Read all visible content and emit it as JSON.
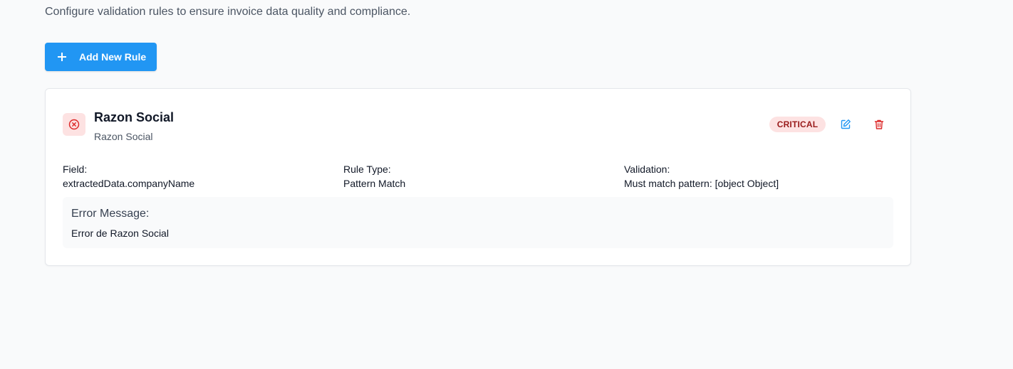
{
  "header": {
    "subtitle": "Configure validation rules to ensure invoice data quality and compliance."
  },
  "toolbar": {
    "add_label": "Add New Rule",
    "add_icon": "plus-icon",
    "accent_color": "#2196f3"
  },
  "rules": [
    {
      "title": "Razon Social",
      "description": "Razon Social",
      "status_icon": "x-circle-icon",
      "severity": "CRITICAL",
      "severity_color": "#991b1b",
      "severity_bg": "#fde2e2",
      "field_label": "Field:",
      "field_value": "extractedData.companyName",
      "type_label": "Rule Type:",
      "type_value": "Pattern Match",
      "validation_label": "Validation:",
      "validation_value": "Must match pattern: [object Object]",
      "error_label": "Error Message:",
      "error_value": "Error de Razon Social",
      "edit_icon": "edit-icon",
      "delete_icon": "trash-icon"
    }
  ]
}
